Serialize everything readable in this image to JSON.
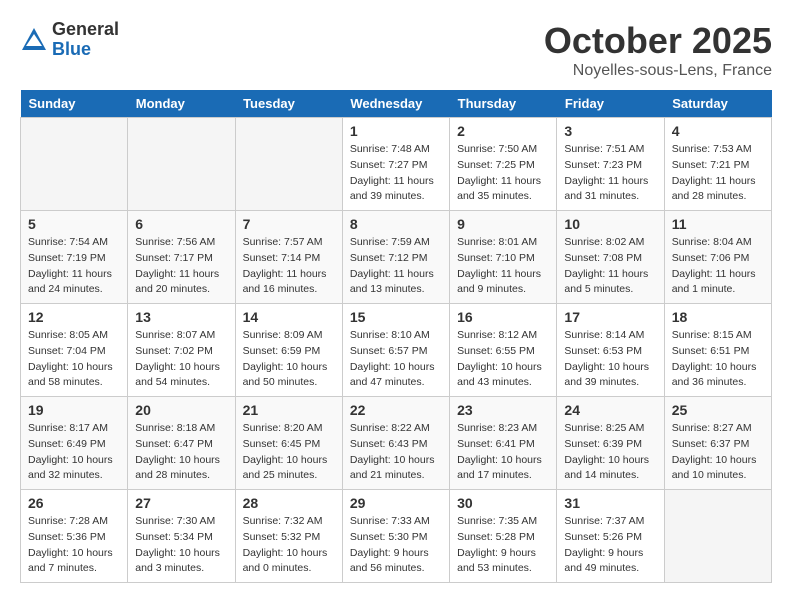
{
  "logo": {
    "general": "General",
    "blue": "Blue"
  },
  "title": {
    "month": "October 2025",
    "location": "Noyelles-sous-Lens, France"
  },
  "headers": [
    "Sunday",
    "Monday",
    "Tuesday",
    "Wednesday",
    "Thursday",
    "Friday",
    "Saturday"
  ],
  "weeks": [
    [
      {
        "day": "",
        "info": ""
      },
      {
        "day": "",
        "info": ""
      },
      {
        "day": "",
        "info": ""
      },
      {
        "day": "1",
        "info": "Sunrise: 7:48 AM\nSunset: 7:27 PM\nDaylight: 11 hours\nand 39 minutes."
      },
      {
        "day": "2",
        "info": "Sunrise: 7:50 AM\nSunset: 7:25 PM\nDaylight: 11 hours\nand 35 minutes."
      },
      {
        "day": "3",
        "info": "Sunrise: 7:51 AM\nSunset: 7:23 PM\nDaylight: 11 hours\nand 31 minutes."
      },
      {
        "day": "4",
        "info": "Sunrise: 7:53 AM\nSunset: 7:21 PM\nDaylight: 11 hours\nand 28 minutes."
      }
    ],
    [
      {
        "day": "5",
        "info": "Sunrise: 7:54 AM\nSunset: 7:19 PM\nDaylight: 11 hours\nand 24 minutes."
      },
      {
        "day": "6",
        "info": "Sunrise: 7:56 AM\nSunset: 7:17 PM\nDaylight: 11 hours\nand 20 minutes."
      },
      {
        "day": "7",
        "info": "Sunrise: 7:57 AM\nSunset: 7:14 PM\nDaylight: 11 hours\nand 16 minutes."
      },
      {
        "day": "8",
        "info": "Sunrise: 7:59 AM\nSunset: 7:12 PM\nDaylight: 11 hours\nand 13 minutes."
      },
      {
        "day": "9",
        "info": "Sunrise: 8:01 AM\nSunset: 7:10 PM\nDaylight: 11 hours\nand 9 minutes."
      },
      {
        "day": "10",
        "info": "Sunrise: 8:02 AM\nSunset: 7:08 PM\nDaylight: 11 hours\nand 5 minutes."
      },
      {
        "day": "11",
        "info": "Sunrise: 8:04 AM\nSunset: 7:06 PM\nDaylight: 11 hours\nand 1 minute."
      }
    ],
    [
      {
        "day": "12",
        "info": "Sunrise: 8:05 AM\nSunset: 7:04 PM\nDaylight: 10 hours\nand 58 minutes."
      },
      {
        "day": "13",
        "info": "Sunrise: 8:07 AM\nSunset: 7:02 PM\nDaylight: 10 hours\nand 54 minutes."
      },
      {
        "day": "14",
        "info": "Sunrise: 8:09 AM\nSunset: 6:59 PM\nDaylight: 10 hours\nand 50 minutes."
      },
      {
        "day": "15",
        "info": "Sunrise: 8:10 AM\nSunset: 6:57 PM\nDaylight: 10 hours\nand 47 minutes."
      },
      {
        "day": "16",
        "info": "Sunrise: 8:12 AM\nSunset: 6:55 PM\nDaylight: 10 hours\nand 43 minutes."
      },
      {
        "day": "17",
        "info": "Sunrise: 8:14 AM\nSunset: 6:53 PM\nDaylight: 10 hours\nand 39 minutes."
      },
      {
        "day": "18",
        "info": "Sunrise: 8:15 AM\nSunset: 6:51 PM\nDaylight: 10 hours\nand 36 minutes."
      }
    ],
    [
      {
        "day": "19",
        "info": "Sunrise: 8:17 AM\nSunset: 6:49 PM\nDaylight: 10 hours\nand 32 minutes."
      },
      {
        "day": "20",
        "info": "Sunrise: 8:18 AM\nSunset: 6:47 PM\nDaylight: 10 hours\nand 28 minutes."
      },
      {
        "day": "21",
        "info": "Sunrise: 8:20 AM\nSunset: 6:45 PM\nDaylight: 10 hours\nand 25 minutes."
      },
      {
        "day": "22",
        "info": "Sunrise: 8:22 AM\nSunset: 6:43 PM\nDaylight: 10 hours\nand 21 minutes."
      },
      {
        "day": "23",
        "info": "Sunrise: 8:23 AM\nSunset: 6:41 PM\nDaylight: 10 hours\nand 17 minutes."
      },
      {
        "day": "24",
        "info": "Sunrise: 8:25 AM\nSunset: 6:39 PM\nDaylight: 10 hours\nand 14 minutes."
      },
      {
        "day": "25",
        "info": "Sunrise: 8:27 AM\nSunset: 6:37 PM\nDaylight: 10 hours\nand 10 minutes."
      }
    ],
    [
      {
        "day": "26",
        "info": "Sunrise: 7:28 AM\nSunset: 5:36 PM\nDaylight: 10 hours\nand 7 minutes."
      },
      {
        "day": "27",
        "info": "Sunrise: 7:30 AM\nSunset: 5:34 PM\nDaylight: 10 hours\nand 3 minutes."
      },
      {
        "day": "28",
        "info": "Sunrise: 7:32 AM\nSunset: 5:32 PM\nDaylight: 10 hours\nand 0 minutes."
      },
      {
        "day": "29",
        "info": "Sunrise: 7:33 AM\nSunset: 5:30 PM\nDaylight: 9 hours\nand 56 minutes."
      },
      {
        "day": "30",
        "info": "Sunrise: 7:35 AM\nSunset: 5:28 PM\nDaylight: 9 hours\nand 53 minutes."
      },
      {
        "day": "31",
        "info": "Sunrise: 7:37 AM\nSunset: 5:26 PM\nDaylight: 9 hours\nand 49 minutes."
      },
      {
        "day": "",
        "info": ""
      }
    ]
  ]
}
